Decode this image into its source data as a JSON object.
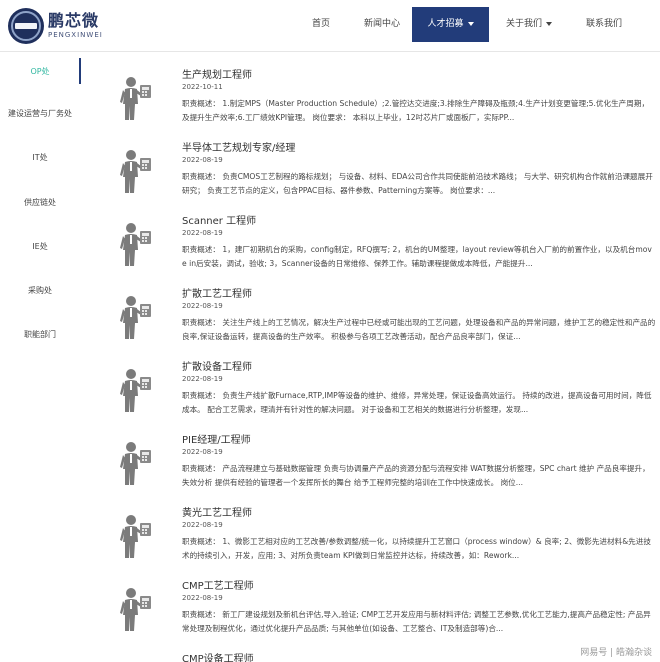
{
  "brand": {
    "name_cn": "鹏芯微",
    "name_en": "PENGXINWEI"
  },
  "nav": {
    "items": [
      {
        "label": "首页",
        "active": false,
        "dropdown": false
      },
      {
        "label": "新闻中心",
        "active": false,
        "dropdown": false
      },
      {
        "label": "人才招募",
        "active": true,
        "dropdown": true
      },
      {
        "label": "关于我们",
        "active": false,
        "dropdown": true
      },
      {
        "label": "联系我们",
        "active": false,
        "dropdown": false
      }
    ]
  },
  "sidebar": {
    "items": [
      {
        "label": "OP处",
        "active": true
      },
      {
        "label": "建设运营与厂务处",
        "active": false
      },
      {
        "label": "IT处",
        "active": false
      },
      {
        "label": "供应链处",
        "active": false
      },
      {
        "label": "IE处",
        "active": false
      },
      {
        "label": "采购处",
        "active": false
      },
      {
        "label": "职能部门",
        "active": false
      }
    ]
  },
  "jobs": [
    {
      "title": "生产规划工程师",
      "date": "2022-10-11",
      "desc": "职责概述： 1.制定MPS（Master Production Schedule）;2.管控达交进度;3.排除生产障碍及瓶颈;4.生产计划变更管理;5.优化生产周期，及提升生产效率;6.工厂绩效KPI管理。 岗位要求： 本科以上毕业，12吋芯片厂或面板厂，实际PP..."
    },
    {
      "title": "半导体工艺规划专家/经理",
      "date": "2022-08-19",
      "desc": "职责概述： 负责CMOS工艺制程的路标规划； 与设备、材料、EDA公司合作共同使能前沿技术路线； 与大学、研究机构合作就前沿课题展开研究； 负责工艺节点的定义，包含PPAC目标、器件参数、Patterning方案等。 岗位要求：..."
    },
    {
      "title": "Scanner 工程师",
      "date": "2022-08-19",
      "desc": "职责概述： 1，建厂初期机台的采购，config制定，RFQ撰写; 2，机台的UM整理，layout review等机台入厂前的前置作业，以及机台move in后安装，调试，验收; 3，Scanner设备的日常维修、保养工作。辅助课程提做成本降低，产能提升..."
    },
    {
      "title": "扩散工艺工程师",
      "date": "2022-08-19",
      "desc": "职责概述： 关注生产线上的工艺情况，解决生产过程中已经或可能出现的工艺问题，处理设备和产品的异常问题，维护工艺的稳定性和产品的良率,保证设备运转，提高设备的生产效率。 积极参与各项工艺改善活动，配合产品良率部门，保证..."
    },
    {
      "title": "扩散设备工程师",
      "date": "2022-08-19",
      "desc": "职责概述： 负责生产线扩散Furnace,RTP,IMP等设备的维护、维修，异常处理，保证设备高效运行。 持续的改进，提高设备可用时间，降低成本。 配合工艺需求，理清并有针对性的解决问题。 对于设备和工艺相关的数据进行分析整理，发现..."
    },
    {
      "title": "PIE经理/工程师",
      "date": "2022-08-19",
      "desc": "职责概述： 产品流程建立与基础数据管理 负责与协调量产产品的资源分配与流程安排 WAT数据分析整理，SPC chart 维护 产品良率提升，失效分析 提供有经验的管理者一个发挥所长的舞台 给予工程师完整的培训在工作中快速成长。 岗位..."
    },
    {
      "title": "黄光工艺工程师",
      "date": "2022-08-19",
      "desc": "职责概述： 1、微影工艺相对应的工艺改善/参数调整/统一化，以持续提升工艺窗口（process window）& 良率; 2、微影先进材料&先进技术的持续引入，开发，应用; 3、对所负责team KPI做到日常监控并达标，持续改善，如：Rework..."
    },
    {
      "title": "CMP工艺工程师",
      "date": "2022-08-19",
      "desc": "职责概述： 新工厂建设规划及新机台评估,导入,验证; CMP工艺开发应用与新材料评估; 调整工艺参数,优化工艺能力,提高产品稳定性; 产品异常处理及制程优化，通过优化提升产品品质; 与其他单位(如设备、工艺整合、IT及制造部等)合..."
    },
    {
      "title": "CMP设备工程师",
      "date": "",
      "desc": ""
    }
  ],
  "watermark": "网易号 | 皓瀚杂谈"
}
